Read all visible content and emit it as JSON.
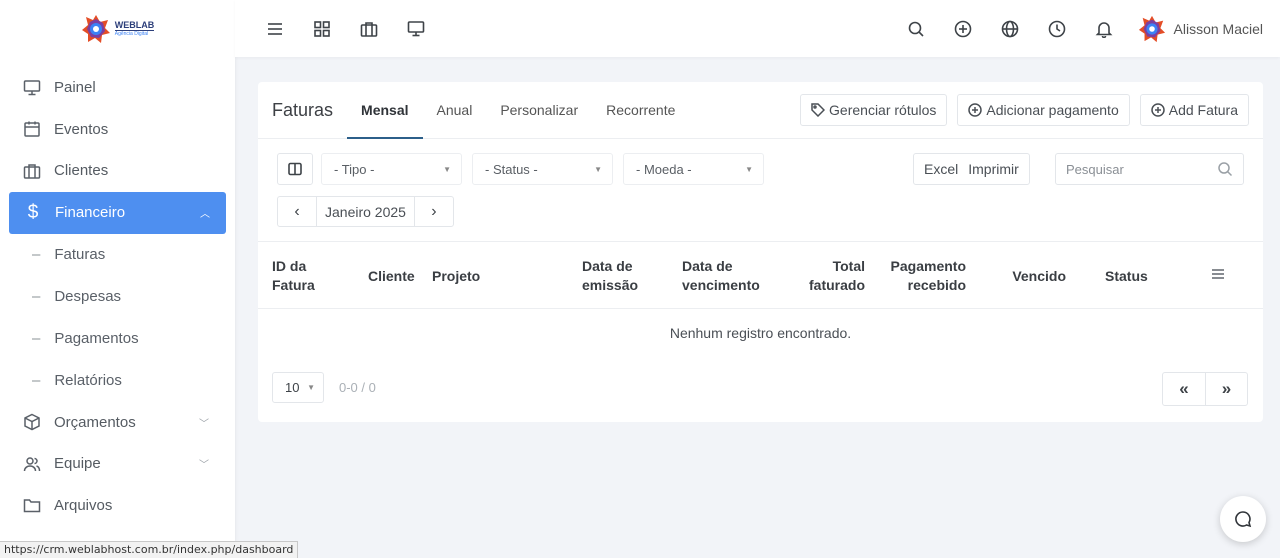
{
  "brand": {
    "line1": "WEBLAB",
    "line2": "Agência Digital"
  },
  "sidebar": {
    "items": [
      {
        "label": "Painel",
        "icon": "monitor-icon"
      },
      {
        "label": "Eventos",
        "icon": "calendar-icon"
      },
      {
        "label": "Clientes",
        "icon": "briefcase-icon"
      },
      {
        "label": "Financeiro",
        "icon": "dollar-icon",
        "active": true
      },
      {
        "label": "Orçamentos",
        "icon": "box-icon"
      },
      {
        "label": "Equipe",
        "icon": "users-icon"
      },
      {
        "label": "Arquivos",
        "icon": "folder-icon"
      }
    ],
    "subitems": [
      "Faturas",
      "Despesas",
      "Pagamentos",
      "Relatórios"
    ]
  },
  "topbar": {
    "username": "Alisson Maciel"
  },
  "card": {
    "title": "Faturas",
    "tabs": [
      "Mensal",
      "Anual",
      "Personalizar",
      "Recorrente"
    ],
    "buttons": {
      "labels": "Gerenciar rótulos",
      "add_payment": "Adicionar pagamento",
      "add_invoice": "Add Fatura"
    },
    "filters": {
      "type": "- Tipo -",
      "status": "- Status -",
      "currency": "- Moeda -"
    },
    "export": {
      "excel": "Excel",
      "print": "Imprimir"
    },
    "search_placeholder": "Pesquisar",
    "month": "Janeiro 2025",
    "columns": {
      "id_1": "ID da",
      "id_2": "Fatura",
      "client": "Cliente",
      "project": "Projeto",
      "issue_1": "Data de",
      "issue_2": "emissão",
      "due_1": "Data de",
      "due_2": "vencimento",
      "total_1": "Total",
      "total_2": "faturado",
      "paid_1": "Pagamento",
      "paid_2": "recebido",
      "overdue": "Vencido",
      "status": "Status"
    },
    "empty": "Nenhum registro encontrado.",
    "page_size": "10",
    "page_info": "0-0 / 0"
  },
  "statusbar": "https://crm.weblabhost.com.br/index.php/dashboard",
  "colors": {
    "accent": "#4e8ff0",
    "tab_underline": "#2c5f8a"
  }
}
